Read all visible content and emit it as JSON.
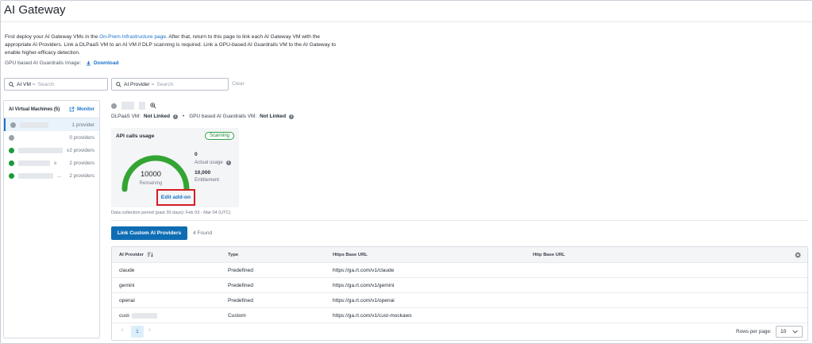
{
  "page": {
    "title": "AI Gateway"
  },
  "intro": {
    "text_before": "First deploy your AI Gateway VMs in the ",
    "link": "On-Prem Infrastructure page",
    "text_after": ". After that, return to this page to link each AI Gateway VM with the appropriate AI Providers. Link a DLPaaS VM to an AI VM if DLP scanning is required. Link a GPU-based AI Guardrails VM to the AI Gateway to enable higher-efficacy detection."
  },
  "gpu_image": {
    "label": "GPU based AI Guardrails Image:",
    "download": "Download"
  },
  "filters": {
    "vm": {
      "label": "AI VM ~",
      "placeholder": "Search"
    },
    "provider": {
      "label": "AI Provider ~",
      "placeholder": "Search"
    },
    "clear": "Clear"
  },
  "vm_list": {
    "title": "AI Virtual Machines (5)",
    "monitor": "Monitor",
    "items": [
      {
        "status": "gray",
        "providers": "1 provider",
        "suffix": ""
      },
      {
        "status": "gray",
        "providers": "0 providers",
        "suffix": ""
      },
      {
        "status": "green",
        "providers": "2 providers",
        "suffix": "v"
      },
      {
        "status": "green",
        "providers": "2 providers",
        "suffix": "s"
      },
      {
        "status": "green",
        "providers": "2 providers",
        "suffix": "..."
      }
    ]
  },
  "detail": {
    "dlp_label": "DLPaaS VM:",
    "dlp_value": "Not Linked",
    "gpu_label": "GPU based AI Guardrails VM:",
    "gpu_value": "Not Linked",
    "separator": "•"
  },
  "usage": {
    "title": "API calls usage",
    "badge": "Scanning",
    "remaining_value": "10000",
    "remaining_label": "Remaining",
    "actual_value": "0",
    "actual_label": "Actual usage",
    "entitlement_value": "10,000",
    "entitlement_label": "Entitlement",
    "remaining_fraction": 1.0,
    "edit": "Edit add-on",
    "period": "Data collection period (past 30 days): Feb 03 - Mar 04 (UTC)"
  },
  "providers": {
    "link_button": "Link Custom AI Providers",
    "found": "4 Found",
    "columns": [
      "AI Provider",
      "Type",
      "Https Base URL",
      "Http Base URL"
    ],
    "rows": [
      {
        "name": "claude",
        "type": "Predefined",
        "https": "https://ga.rt.com/v1/claude",
        "http": ""
      },
      {
        "name": "gemini",
        "type": "Predefined",
        "https": "https://ga.rt.com/v1/gemini",
        "http": ""
      },
      {
        "name": "openai",
        "type": "Predefined",
        "https": "https://ga.rt.com/v1/openai",
        "http": ""
      },
      {
        "name": "cust-",
        "type": "Custom",
        "https": "https://ga.rt.com/v1/cust-mockaws",
        "http": ""
      }
    ],
    "page": "1",
    "rows_per_page_label": "Rows per page:",
    "rows_per_page": "10"
  },
  "colors": {
    "accent": "#0f6db4",
    "ok": "#2fa24a",
    "highlight": "#d81b22"
  }
}
